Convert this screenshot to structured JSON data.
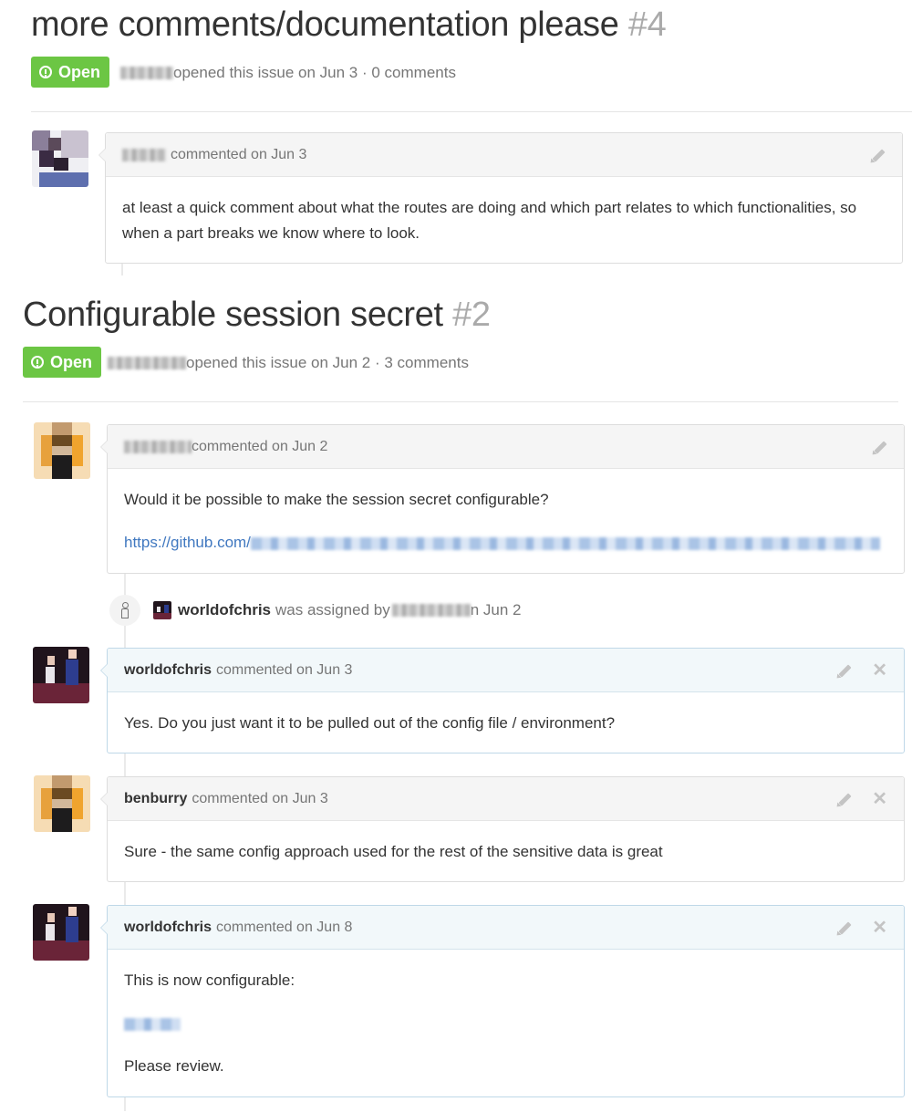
{
  "issues": [
    {
      "title": "more comments/documentation please",
      "number": "#4",
      "status": "Open",
      "meta": "opened this issue on Jun 3 · 0 comments",
      "comments": [
        {
          "author": "",
          "action": "commented on Jun 3",
          "body": "at least a quick comment about what the routes are doing and which part relates to which functionalities, so when a part breaks we know where to look."
        }
      ]
    },
    {
      "title": "Configurable session secret",
      "number": "#2",
      "status": "Open",
      "meta": "opened this issue on Jun 2 · 3 comments",
      "comments": [
        {
          "author": "",
          "action": "commented on Jun 2",
          "body": "Would it be possible to make the session secret configurable?",
          "link": "https://github.com/"
        },
        {
          "author": "worldofchris",
          "action": "commented on Jun 3",
          "body": "Yes. Do you just want it to be pulled out of the config file / environment?"
        },
        {
          "author": "benburry",
          "action": "commented on Jun 3",
          "body": "Sure - the same config approach used for the rest of the sensitive data is great"
        },
        {
          "author": "worldofchris",
          "action": "commented on Jun 8",
          "body": "This is now configurable:",
          "body2": "Please review."
        }
      ],
      "event": {
        "user": "worldofchris",
        "text": "was assigned by",
        "suffix": "n Jun 2"
      }
    }
  ],
  "colors": {
    "open_badge": "#6cc644",
    "link": "#4078c0",
    "owner_header": "#f2f8fa"
  }
}
